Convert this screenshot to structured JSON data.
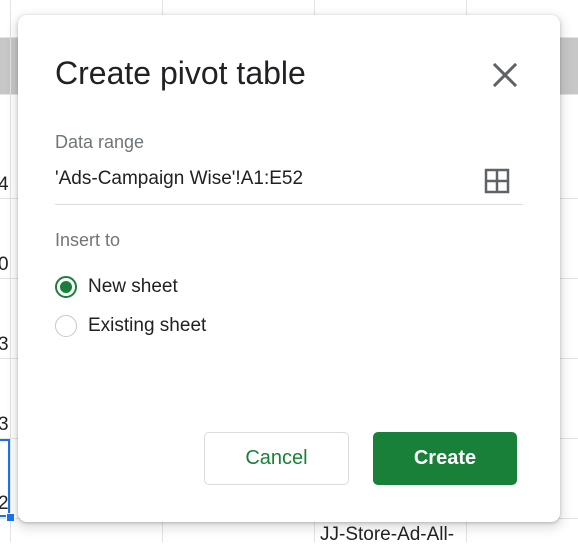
{
  "background": {
    "row_numbers": [
      "4",
      "0",
      "3",
      "3",
      "2"
    ],
    "cell_text": "JJ-Store-Ad-All-"
  },
  "dialog": {
    "title": "Create pivot table",
    "close_icon": "close-icon",
    "data_range": {
      "label": "Data range",
      "value": "'Ads-Campaign Wise'!A1:E52",
      "icon": "grid-icon"
    },
    "insert_to": {
      "label": "Insert to",
      "options": [
        {
          "label": "New sheet",
          "selected": true
        },
        {
          "label": "Existing sheet",
          "selected": false
        }
      ]
    },
    "buttons": {
      "cancel": "Cancel",
      "create": "Create"
    }
  },
  "colors": {
    "accent": "#188038",
    "selection": "#1a73e8"
  }
}
